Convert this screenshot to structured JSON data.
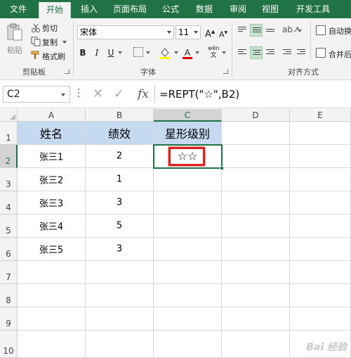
{
  "ribbon_tabs": [
    "文件",
    "开始",
    "插入",
    "页面布局",
    "公式",
    "数据",
    "审阅",
    "视图",
    "开发工具"
  ],
  "clipboard": {
    "paste_label": "粘贴",
    "cut_label": "剪切",
    "copy_label": "复制",
    "format_painter_label": "格式刷",
    "group_label": "剪贴板"
  },
  "font": {
    "name": "宋体",
    "size": "11",
    "bold": "B",
    "italic": "I",
    "underline": "U",
    "grow": "A",
    "shrink": "A",
    "color_a": "A",
    "wen": "wén",
    "group_label": "字体"
  },
  "alignment": {
    "wrap_label": "自动换",
    "merge_label": "合并后",
    "group_label": "对齐方式"
  },
  "formula_bar": {
    "name_box": "C2",
    "fx": "fx",
    "cancel": "✕",
    "enter": "✓",
    "formula": "=REPT(\"☆\",B2)"
  },
  "columns": [
    "A",
    "B",
    "C",
    "D",
    "E"
  ],
  "rows": [
    "1",
    "2",
    "3",
    "4",
    "5",
    "6",
    "7",
    "8",
    "9",
    "10"
  ],
  "table": {
    "headers": [
      "姓名",
      "绩效",
      "星形级别"
    ],
    "rows": [
      {
        "name": "张三1",
        "score": "2",
        "stars": "☆☆"
      },
      {
        "name": "张三2",
        "score": "1",
        "stars": ""
      },
      {
        "name": "张三3",
        "score": "3",
        "stars": ""
      },
      {
        "name": "张三4",
        "score": "5",
        "stars": ""
      },
      {
        "name": "张三5",
        "score": "3",
        "stars": ""
      }
    ]
  },
  "colors": {
    "accent": "#217346",
    "header_fill": "#c5d9f1",
    "highlight": "#dd2222"
  },
  "watermark": "Bai 经验"
}
